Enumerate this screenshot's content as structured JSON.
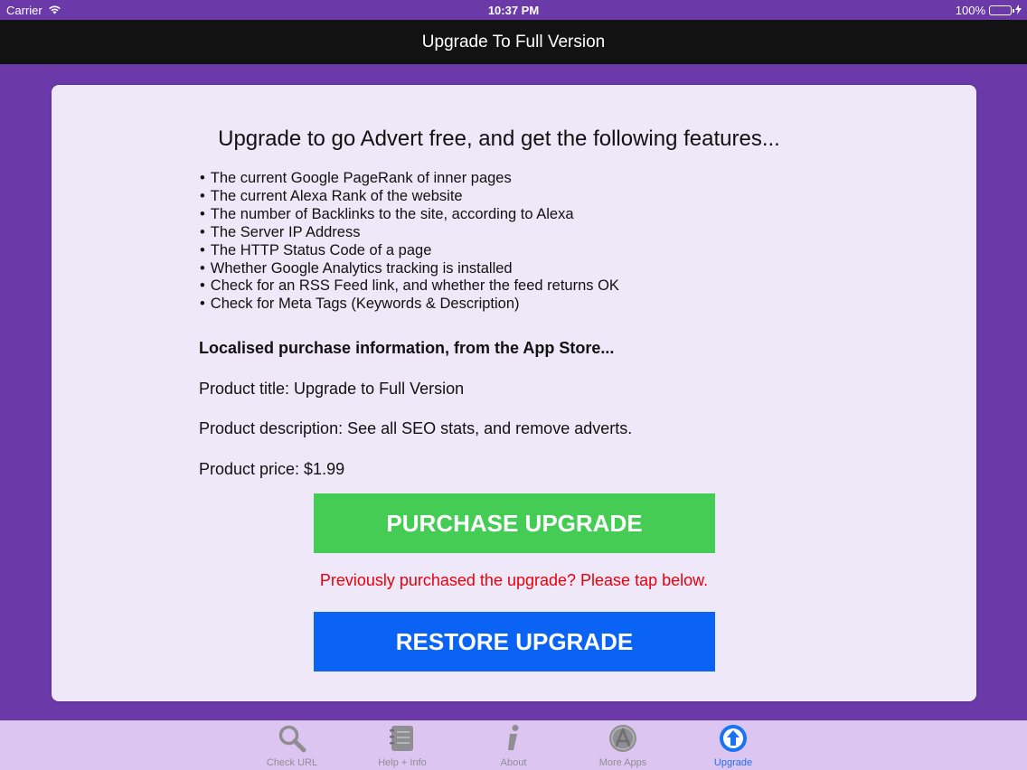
{
  "status_bar": {
    "carrier": "Carrier",
    "time": "10:37 PM",
    "battery": "100%"
  },
  "nav": {
    "title": "Upgrade To Full Version"
  },
  "content": {
    "headline": "Upgrade to go Advert free, and get the following features...",
    "features": [
      "The current Google PageRank of inner pages",
      "The current Alexa Rank of the website",
      "The number of Backlinks to the site, according to Alexa",
      "The Server IP Address",
      "The HTTP Status Code of a page",
      "Whether Google Analytics tracking is installed",
      "Check for an RSS Feed link, and whether the feed returns OK",
      "Check for Meta Tags (Keywords & Description)"
    ],
    "purchase_info_title": "Localised purchase information, from the App Store...",
    "product_title": "Product title: Upgrade to Full Version",
    "product_description": "Product description: See all SEO stats, and remove adverts.",
    "product_price": "Product price: $1.99",
    "purchase_button": "PURCHASE UPGRADE",
    "restore_hint": "Previously purchased the upgrade? Please tap below.",
    "restore_button": "RESTORE UPGRADE"
  },
  "tabs": [
    {
      "label": "Check URL",
      "icon": "magnifier-icon",
      "active": false
    },
    {
      "label": "Help + Info",
      "icon": "notebook-icon",
      "active": false
    },
    {
      "label": "About",
      "icon": "info-icon",
      "active": false
    },
    {
      "label": "More Apps",
      "icon": "app-store-icon",
      "active": false
    },
    {
      "label": "Upgrade",
      "icon": "upgrade-arrow-icon",
      "active": true
    }
  ],
  "colors": {
    "background": "#6b3aa8",
    "card": "#efe8f8",
    "purchase": "#45cc55",
    "restore": "#0b63f6",
    "hint": "#e8000b",
    "tab_active": "#1a73f2",
    "tab_inactive": "#8e8e93"
  }
}
